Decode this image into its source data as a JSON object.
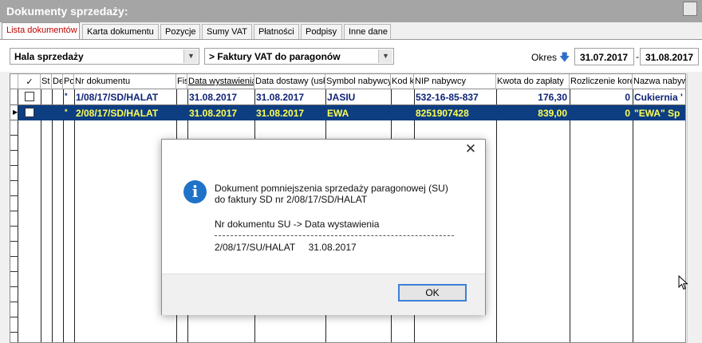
{
  "window": {
    "title": "Dokumenty sprzedaży:"
  },
  "tabs": [
    {
      "label": "Lista dokumentów",
      "active": true
    },
    {
      "label": "Karta dokumentu"
    },
    {
      "label": "Pozycje"
    },
    {
      "label": "Sumy VAT"
    },
    {
      "label": "Płatności"
    },
    {
      "label": "Podpisy"
    },
    {
      "label": "Inne dane"
    }
  ],
  "filters": {
    "register": "Hala sprzedaży",
    "doc_type": "> Faktury VAT do paragonów",
    "period_label": "Okres",
    "date_from": "31.07.2017",
    "date_sep": "-",
    "date_to": "31.08.2017"
  },
  "table": {
    "columns": [
      "✓",
      "St",
      "De",
      "Po",
      "Nr dokumentu",
      "Fis",
      "Data wystawienia",
      "Data dostawy (usł",
      "Symbol nabywcy",
      "Kod ki",
      "NIP nabywcy",
      "Kwota do zapłaty",
      "Rozliczenie korekt",
      "Nazwa nabywcy"
    ],
    "rows": [
      {
        "marker": "*",
        "nr": "1/08/17/SD/HALAT",
        "data_wyst": "31.08.2017",
        "data_dost": "31.08.2017",
        "symbol": "JASIU",
        "nip": "532-16-85-837",
        "kwota": "176,30",
        "korekt": "0",
        "nazwa": "Cukiernia '",
        "selected": false
      },
      {
        "marker": "*",
        "nr": "2/08/17/SD/HALAT",
        "data_wyst": "31.08.2017",
        "data_dost": "31.08.2017",
        "symbol": "EWA",
        "nip": "8251907428",
        "kwota": "839,00",
        "korekt": "0",
        "nazwa": "\"EWA\" Sp",
        "selected": true
      }
    ]
  },
  "dialog": {
    "message_line1": "Dokument pomniejszenia sprzedaży paragonowej (SU)",
    "message_line2": "do faktury SD nr 2/08/17/SD/HALAT",
    "detail_header": "Nr dokumentu SU -> Data wystawienia",
    "detail_value": "2/08/17/SU/HALAT     31.08.2017",
    "ok_label": "OK",
    "close_glyph": "✕",
    "info_glyph": "i"
  },
  "colors": {
    "selected_row": "#0d3e82",
    "selected_text": "#ffff55",
    "row_text": "#0f2378",
    "active_tab_text": "#c00000"
  }
}
